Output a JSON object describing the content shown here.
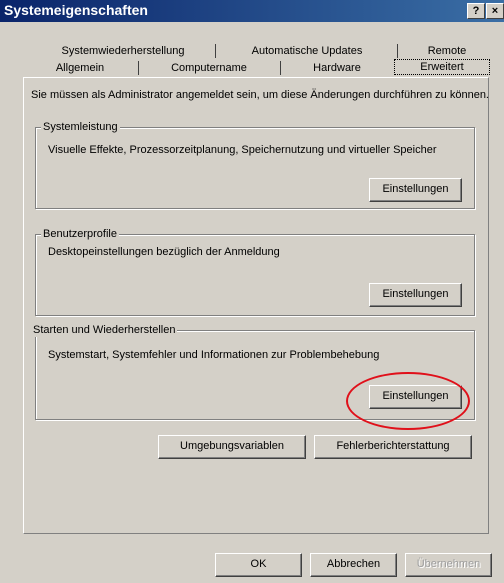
{
  "window": {
    "title": "Systemeigenschaften",
    "help_label": "?",
    "close_label": "×"
  },
  "tabs": {
    "row1": [
      {
        "label": "Systemwiederherstellung"
      },
      {
        "label": "Automatische Updates"
      },
      {
        "label": "Remote"
      }
    ],
    "row2": [
      {
        "label": "Allgemein"
      },
      {
        "label": "Computername"
      },
      {
        "label": "Hardware"
      },
      {
        "label": "Erweitert",
        "selected": true
      }
    ]
  },
  "panel": {
    "admin_notice": "Sie müssen als Administrator angemeldet sein, um diese Änderungen durchführen zu können.",
    "groups": [
      {
        "title": "Systemleistung",
        "description": "Visuelle Effekte, Prozessorzeitplanung, Speichernutzung und virtueller Speicher",
        "button_label": "Einstellungen"
      },
      {
        "title": "Benutzerprofile",
        "description": "Desktopeinstellungen bezüglich der Anmeldung",
        "button_label": "Einstellungen"
      },
      {
        "title": "Starten und Wiederherstellen",
        "description": "Systemstart, Systemfehler und Informationen zur Problembehebung",
        "button_label": "Einstellungen",
        "highlighted": true
      }
    ],
    "env_vars_label": "Umgebungsvariablen",
    "error_report_label": "Fehlerberichterstattung"
  },
  "footer": {
    "ok_label": "OK",
    "cancel_label": "Abbrechen",
    "apply_label": "Übernehmen",
    "apply_disabled": true
  },
  "colors": {
    "highlight_circle": "#e0101a",
    "title_bar": "#0a246a"
  }
}
